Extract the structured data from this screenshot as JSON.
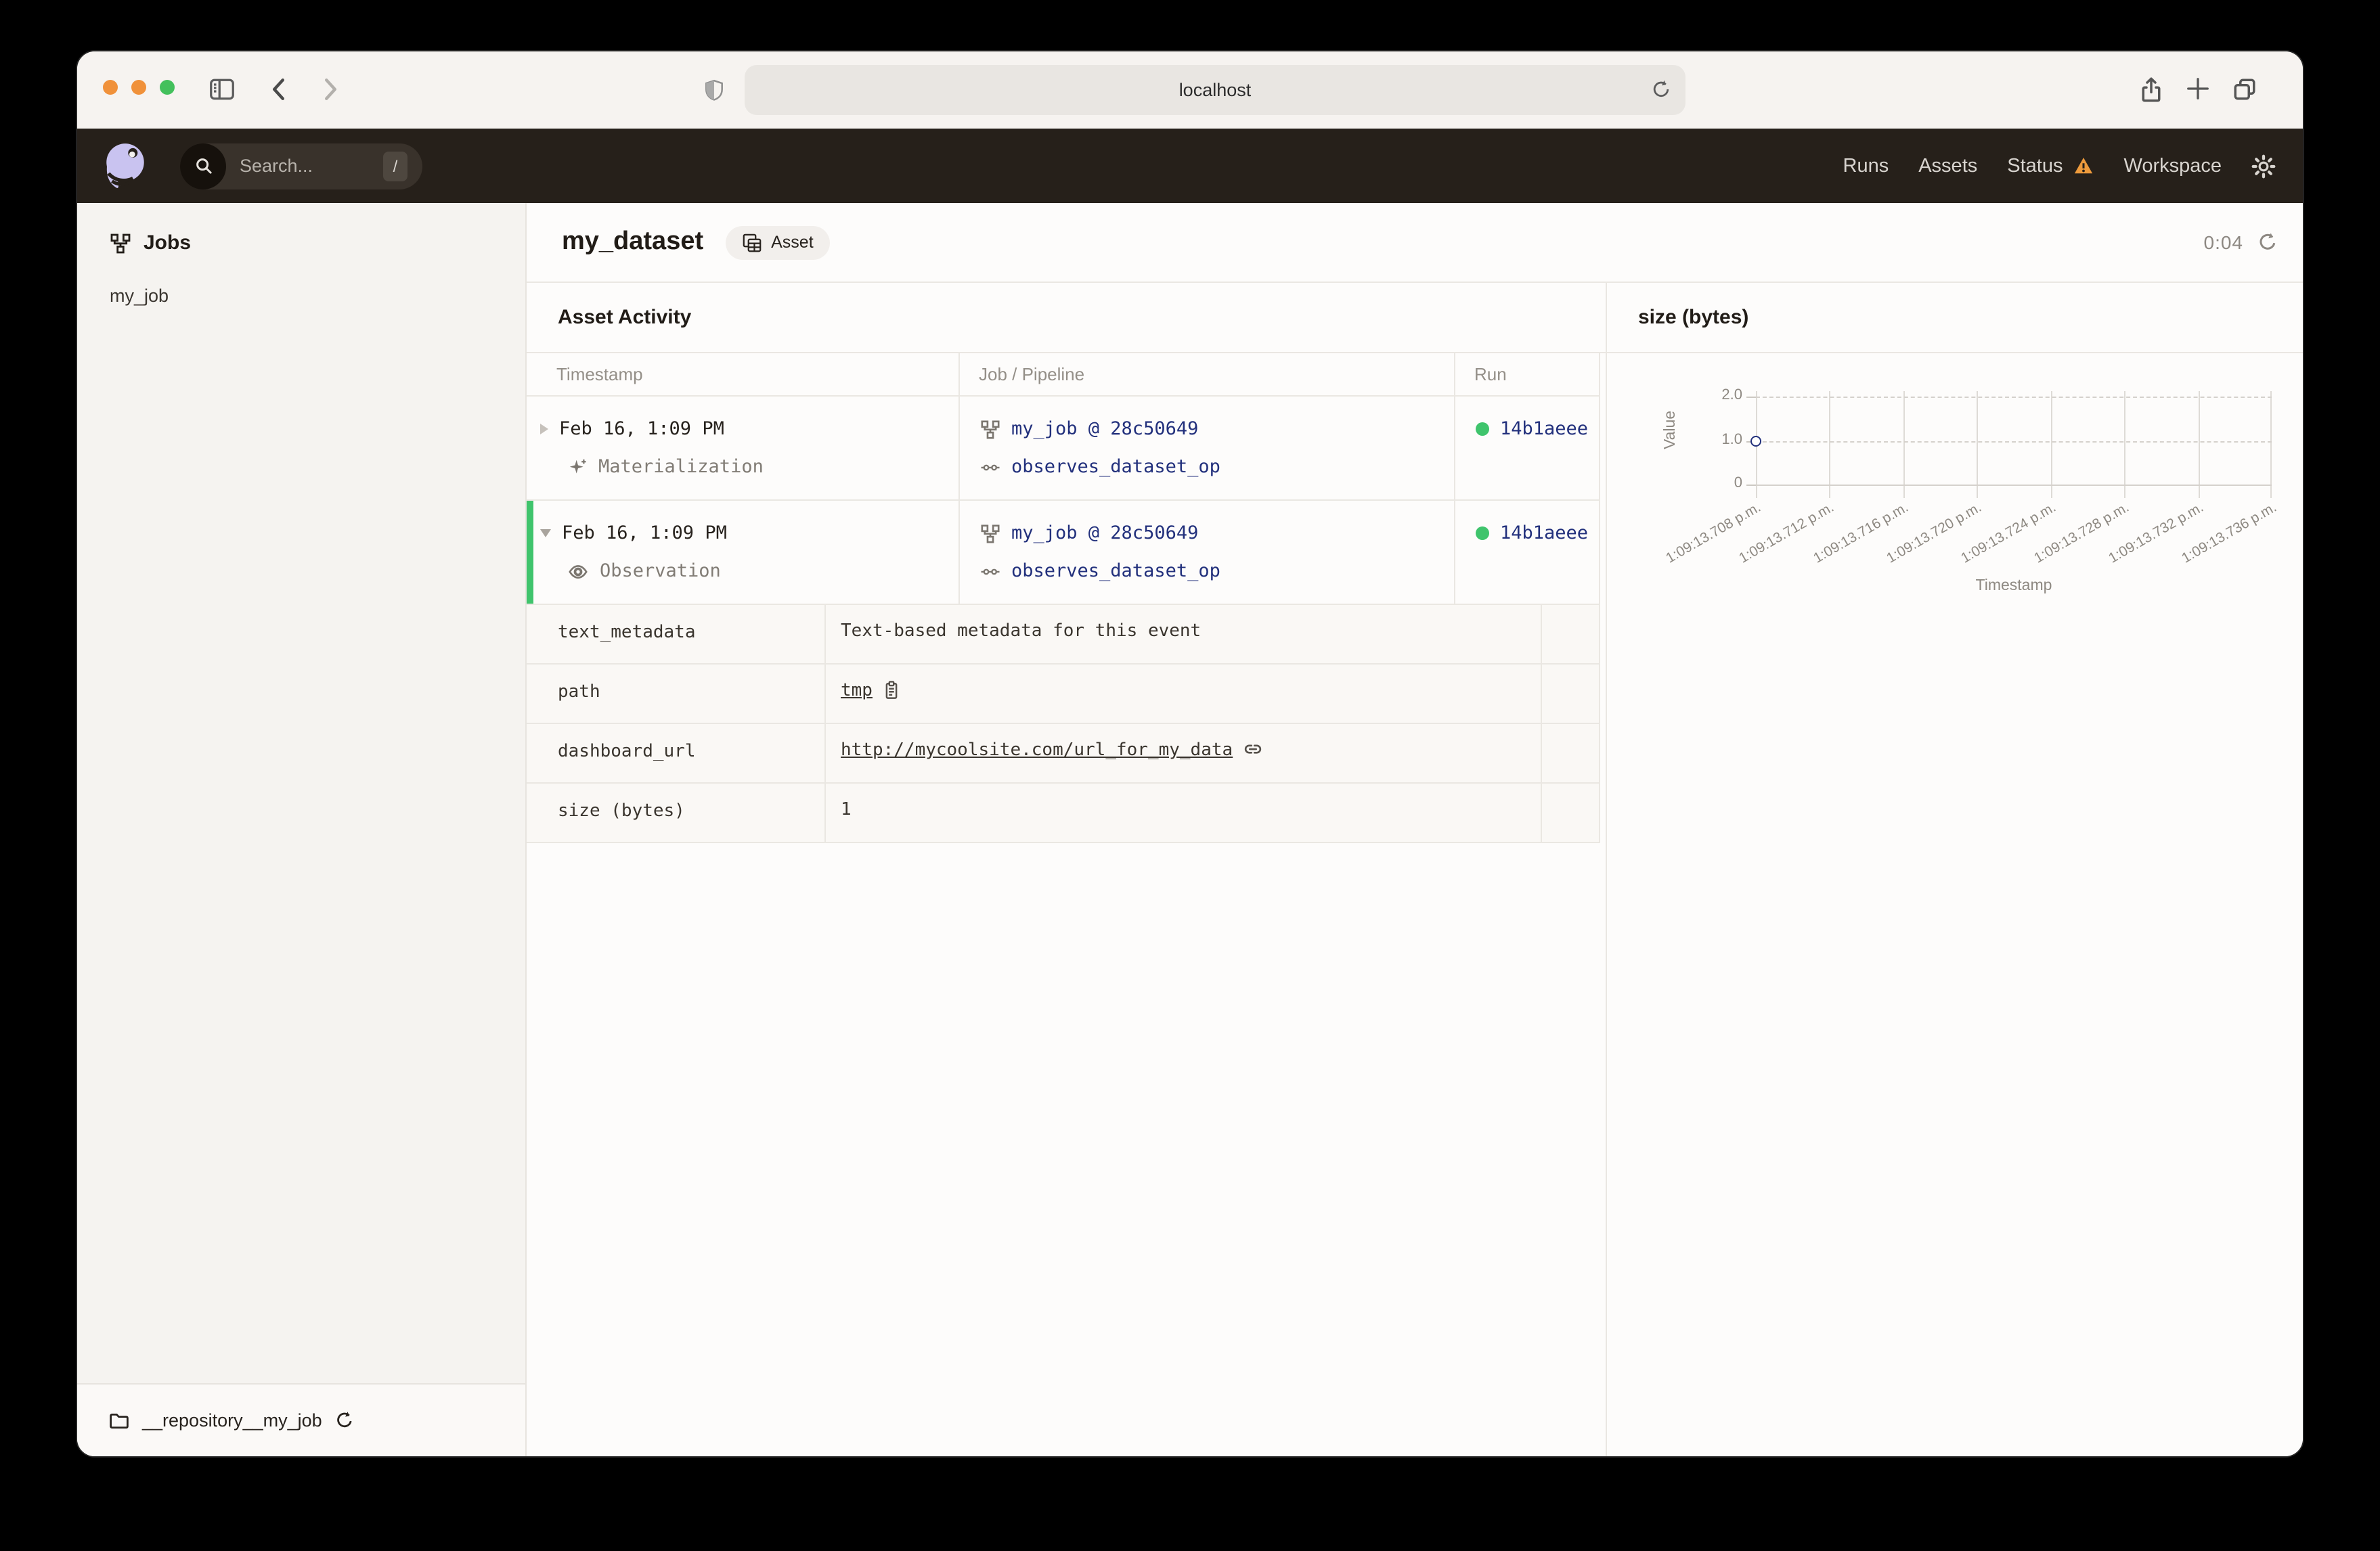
{
  "colors": {
    "nav_bg": "#26201a",
    "accent_green": "#3fc46c",
    "link_navy": "#22307c",
    "warning_orange": "#ed9a3c",
    "logo_lavender": "#c9c3f0",
    "traffic_light_1": "#f0913a",
    "traffic_light_2": "#f0913a",
    "traffic_light_3": "#43c05c"
  },
  "browser": {
    "url": "localhost"
  },
  "topnav": {
    "search_placeholder": "Search...",
    "search_shortcut": "/",
    "runs": "Runs",
    "assets": "Assets",
    "status": "Status",
    "workspace": "Workspace"
  },
  "sidebar": {
    "title": "Jobs",
    "job": "my_job",
    "repository": "__repository__my_job"
  },
  "page": {
    "title": "my_dataset",
    "badge": "Asset",
    "timer": "0:04"
  },
  "activity": {
    "title": "Asset Activity",
    "columns": [
      "Timestamp",
      "Job / Pipeline",
      "Run"
    ],
    "rows": [
      {
        "timestamp": "Feb 16, 1:09 PM",
        "event": "Materialization",
        "job": "my_job @ 28c50649",
        "op": "observes_dataset_op",
        "run": "14b1aeee",
        "expanded": false
      },
      {
        "timestamp": "Feb 16, 1:09 PM",
        "event": "Observation",
        "job": "my_job @ 28c50649",
        "op": "observes_dataset_op",
        "run": "14b1aeee",
        "expanded": true
      }
    ],
    "metadata": [
      {
        "key": "text_metadata",
        "value": "Text-based metadata for this event"
      },
      {
        "key": "path",
        "value": "tmp"
      },
      {
        "key": "dashboard_url",
        "value": "http://mycoolsite.com/url_for_my_data"
      },
      {
        "key": "size (bytes)",
        "value": "1"
      }
    ]
  },
  "chart_data": {
    "type": "scatter",
    "title": "size (bytes)",
    "xlabel": "Timestamp",
    "ylabel": "Value",
    "ylim": [
      0,
      2
    ],
    "grid": true,
    "yticks": [
      "2.0",
      "1.0",
      "0"
    ],
    "x_ticks": [
      "1:09:13.708 p.m.",
      "1:09:13.712 p.m.",
      "1:09:13.716 p.m.",
      "1:09:13.720 p.m.",
      "1:09:13.724 p.m.",
      "1:09:13.728 p.m.",
      "1:09:13.732 p.m.",
      "1:09:13.736 p.m."
    ],
    "points": [
      {
        "x": "1:09:13.708 p.m.",
        "y": 1
      }
    ]
  }
}
